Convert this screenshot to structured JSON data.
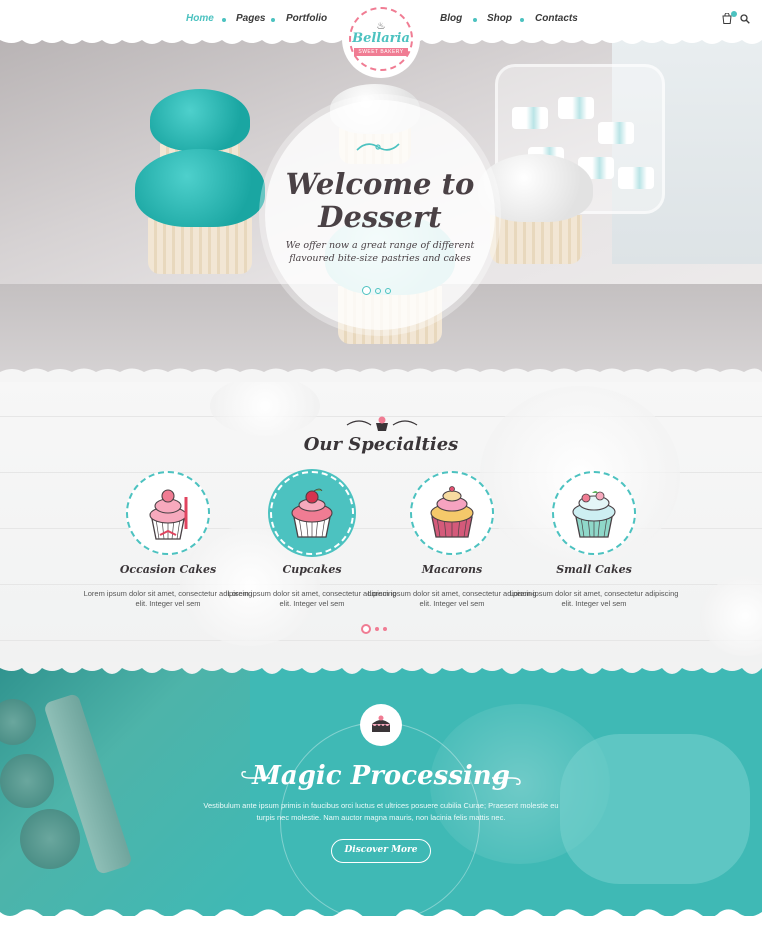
{
  "nav": {
    "left_items": [
      {
        "label": "Home",
        "active": true
      },
      {
        "label": "Pages",
        "active": false
      },
      {
        "label": "Portfolio",
        "active": false
      }
    ],
    "right_items": [
      {
        "label": "Blog",
        "active": false
      },
      {
        "label": "Shop",
        "active": false
      },
      {
        "label": "Contacts",
        "active": false
      }
    ],
    "cart_icon": "shopping-bag-icon",
    "search_icon": "search-icon"
  },
  "logo": {
    "name": "Bellaria",
    "ribbon": "SWEET BAKERY",
    "icon": "chef-hat-icon"
  },
  "hero": {
    "title": "Welcome to Dessert",
    "subtitle": "We offer now a great range of different flavoured bite-size pastries and cakes",
    "slides": 3,
    "active_slide": 1
  },
  "specialties": {
    "title": "Our Specialties",
    "items": [
      {
        "name": "Occasion Cakes",
        "desc": "Lorem ipsum dolor sit amet, consectetur adipiscing elit. Integer vel sem",
        "icon": "cupcake-pink-icon",
        "highlighted": false
      },
      {
        "name": "Cupcakes",
        "desc": "Lorem ipsum dolor sit amet, consectetur adipiscing elit. Integer vel sem",
        "icon": "cupcake-raspberry-icon",
        "highlighted": true
      },
      {
        "name": "Macarons",
        "desc": "Lorem ipsum dolor sit amet, consectetur adipiscing elit. Integer vel sem",
        "icon": "cupcake-swirl-icon",
        "highlighted": false
      },
      {
        "name": "Small Cakes",
        "desc": "Lorem ipsum dolor sit amet, consectetur adipiscing elit. Integer vel sem",
        "icon": "cupcake-flower-icon",
        "highlighted": false
      }
    ],
    "slides": 3,
    "active_slide": 1
  },
  "magic": {
    "title": "Magic Processing",
    "text": "Vestibulum ante ipsum primis in faucibus orci luctus et ultrices posuere cubilia Curae; Praesent molestie eu turpis nec molestie. Nam auctor magna mauris, non lacinia felis mattis nec.",
    "button": "Discover More",
    "icon": "chocolate-cake-icon"
  },
  "colors": {
    "accent": "#4cc2c0",
    "pink": "#f07c93",
    "dark": "#3a3538"
  }
}
